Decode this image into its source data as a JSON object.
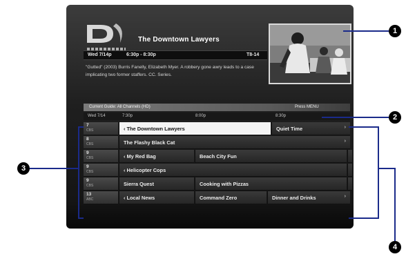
{
  "header": {
    "show_title": "The Downtown Lawyers",
    "date": "Wed 7/14p",
    "time_range": "6:30p - 8:30p",
    "channel": "T8-14"
  },
  "synopsis": "\"Gutted\" (2003) Burris Fanelly, Elizabeth Myer. A robbery gone awry leads to a case implicating two former staffers. CC. Series.",
  "guide_bar": {
    "label": "Current Guide: All Channels (HD)",
    "hint": "Press MENU"
  },
  "time_bar": {
    "date": "Wed 7/14",
    "times": [
      "7:30p",
      "8:00p",
      "8:30p"
    ]
  },
  "rows": [
    {
      "num": "7",
      "call": "CBS",
      "cells": [
        {
          "t": "‹ The Downtown Lawyers",
          "sel": true
        },
        {
          "t": "Quiet Time",
          "arrow": "›"
        }
      ]
    },
    {
      "num": "8",
      "call": "CBS",
      "cells": [
        {
          "t": "The Flashy Black Cat",
          "arrow": "›"
        }
      ]
    },
    {
      "num": "9",
      "call": "CBS",
      "cells": [
        {
          "t": "‹ My Red Bag"
        },
        {
          "t": "Beach City Fun"
        },
        {
          "t": ""
        }
      ]
    },
    {
      "num": "9",
      "call": "CBS",
      "cells": [
        {
          "t": "‹ Helicopter Cops"
        },
        {
          "t": ""
        }
      ]
    },
    {
      "num": "9",
      "call": "CBS",
      "cells": [
        {
          "t": "Sierra Quest"
        },
        {
          "t": "Cooking with Pizzas"
        },
        {
          "t": ""
        }
      ]
    },
    {
      "num": "13",
      "call": "ABC",
      "cells": [
        {
          "t": "‹ Local News"
        },
        {
          "t": "Command Zero"
        },
        {
          "t": "Dinner and Drinks",
          "arrow": "›"
        }
      ]
    }
  ],
  "callouts": [
    "1",
    "2",
    "3",
    "4"
  ],
  "colors": {
    "callout_line": "#1a2a8a",
    "selected_cell": "#f4f4f4"
  }
}
